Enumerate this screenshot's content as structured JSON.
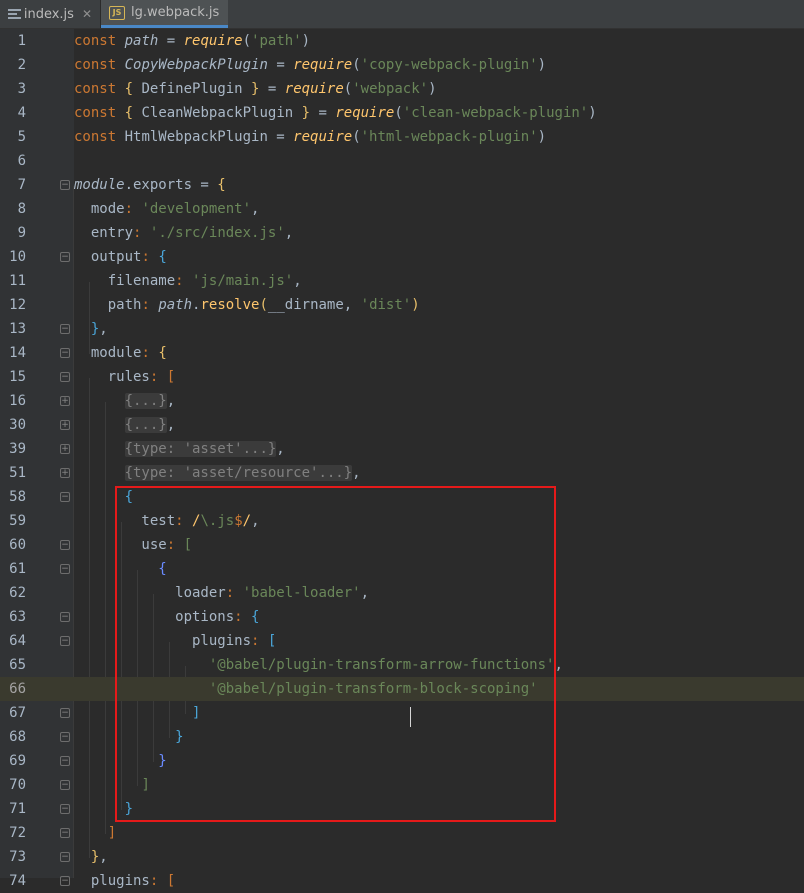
{
  "tabs": [
    {
      "label": "index.js",
      "icon": "list-lines-icon",
      "active": false
    },
    {
      "label": "lg.webpack.js",
      "icon": "js-file-icon",
      "active": true
    }
  ],
  "code": {
    "lines": [
      {
        "num": "1",
        "text": "const path = require('path')"
      },
      {
        "num": "2",
        "text": "const CopyWebpackPlugin = require('copy-webpack-plugin')"
      },
      {
        "num": "3",
        "text": "const { DefinePlugin } = require('webpack')"
      },
      {
        "num": "4",
        "text": "const { CleanWebpackPlugin } = require('clean-webpack-plugin')"
      },
      {
        "num": "5",
        "text": "const HtmlWebpackPlugin = require('html-webpack-plugin')"
      },
      {
        "num": "6",
        "text": ""
      },
      {
        "num": "7",
        "text": "module.exports = {"
      },
      {
        "num": "8",
        "text": "mode: 'development',"
      },
      {
        "num": "9",
        "text": "entry: './src/index.js',"
      },
      {
        "num": "10",
        "text": "output: {"
      },
      {
        "num": "11",
        "text": "filename: 'js/main.js',"
      },
      {
        "num": "12",
        "text": "path: path.resolve(__dirname, 'dist')"
      },
      {
        "num": "13",
        "text": "},"
      },
      {
        "num": "14",
        "text": "module: {"
      },
      {
        "num": "15",
        "text": "rules: ["
      },
      {
        "num": "16",
        "text": "{...},"
      },
      {
        "num": "30",
        "text": "{...},"
      },
      {
        "num": "39",
        "text": "{type: 'asset'...},"
      },
      {
        "num": "51",
        "text": "{type: 'asset/resource'...},"
      },
      {
        "num": "58",
        "text": "{"
      },
      {
        "num": "59",
        "text": "test: /\\.js$/,"
      },
      {
        "num": "60",
        "text": "use: ["
      },
      {
        "num": "61",
        "text": "{"
      },
      {
        "num": "62",
        "text": "loader: 'babel-loader',"
      },
      {
        "num": "63",
        "text": "options: {"
      },
      {
        "num": "64",
        "text": "plugins: ["
      },
      {
        "num": "65",
        "text": "'@babel/plugin-transform-arrow-functions',"
      },
      {
        "num": "66",
        "text": "'@babel/plugin-transform-block-scoping'"
      },
      {
        "num": "67",
        "text": "]"
      },
      {
        "num": "68",
        "text": "}"
      },
      {
        "num": "69",
        "text": "}"
      },
      {
        "num": "70",
        "text": "]"
      },
      {
        "num": "71",
        "text": "}"
      },
      {
        "num": "72",
        "text": "]"
      },
      {
        "num": "73",
        "text": "},"
      },
      {
        "num": "74",
        "text": "plugins: ["
      }
    ],
    "current_line": "66"
  },
  "colors": {
    "background": "#2b2b2b",
    "keyword": "#cc7832",
    "string": "#6a8759",
    "function": "#ffc66d",
    "highlight_box": "#e51a1a",
    "current_line": "#3a3a2e"
  }
}
